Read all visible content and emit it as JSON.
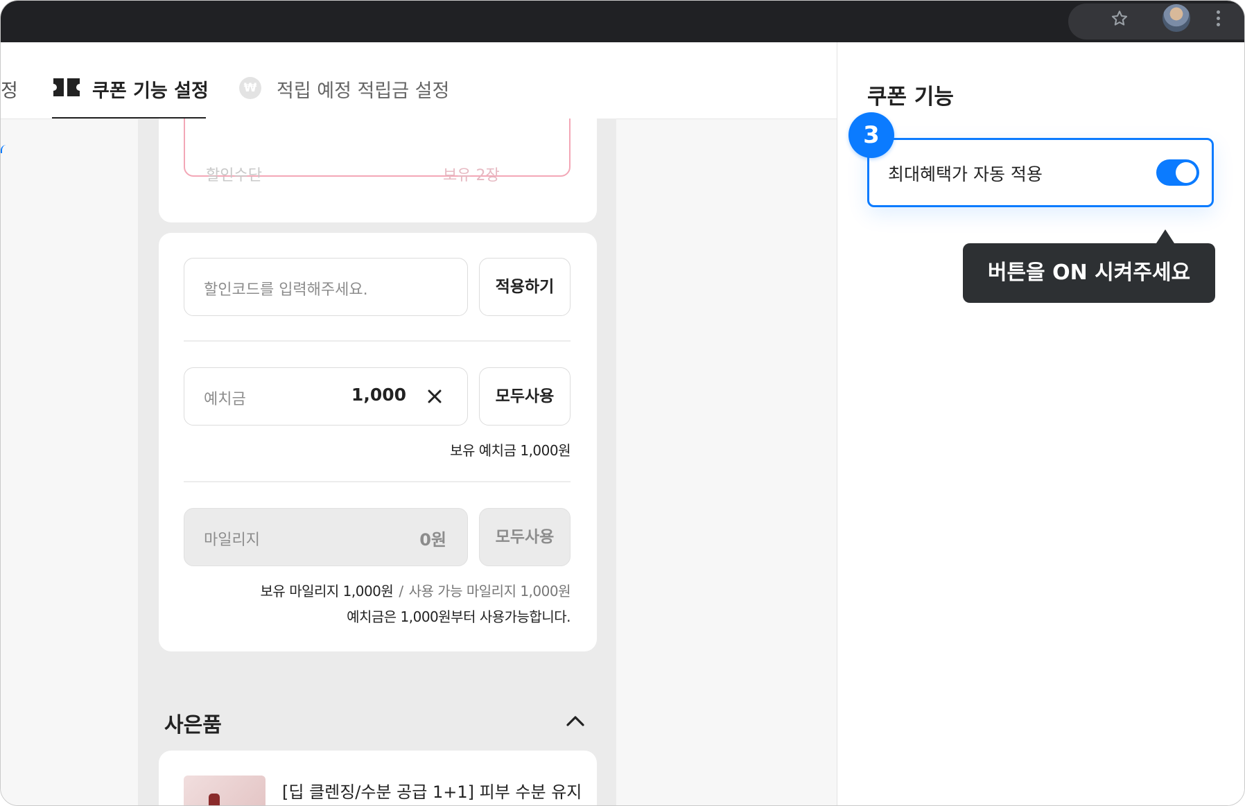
{
  "tabs": {
    "partial_label": "정",
    "coupon_label": "쿠폰 기능 설정",
    "won_symbol": "₩",
    "points_label": "적립 예정 적립금 설정"
  },
  "card_top": {
    "ghost_left": "할인수단",
    "ghost_right": "보유 2장"
  },
  "discount": {
    "placeholder": "할인코드를 입력해주세요.",
    "apply_label": "적용하기"
  },
  "deposit": {
    "label": "예치금",
    "value": "1,000",
    "use_all_label": "모두사용",
    "note": "보유 예치금 1,000원"
  },
  "mileage": {
    "label": "마일리지",
    "value": "0원",
    "use_all_label": "모두사용",
    "held": "보유 마일리지 1,000원",
    "sep": "/",
    "available": "사용 가능 마일리지 1,000원",
    "min_note": "예치금은 1,000원부터 사용가능합니다."
  },
  "gift": {
    "title": "사은품",
    "product_name": "[딥 클렌징/수분 공급 1+1] 피부 수분 유지"
  },
  "right_panel": {
    "title": "쿠폰 기능",
    "step_number": "3",
    "toggle_label": "최대혜택가 자동 적용",
    "toggle_on": true,
    "tooltip": "버튼을 ON 시켜주세요"
  },
  "colors": {
    "accent": "#0b7bff",
    "topbar": "#202124",
    "tooltip_bg": "#2d3033",
    "pink_border": "#f3a7b6"
  }
}
